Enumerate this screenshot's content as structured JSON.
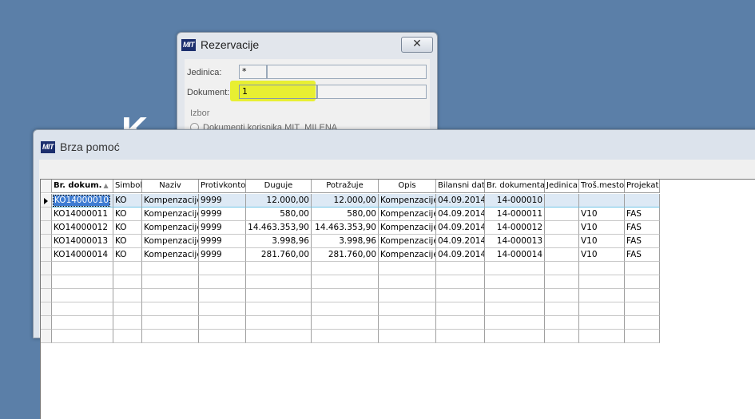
{
  "background": {
    "letter": "K"
  },
  "rezervacije": {
    "title": "Rezervacije",
    "close_glyph": "✕",
    "jedinica_label": "Jedinica:",
    "jedinica_value": "*",
    "jedinica_value2": "",
    "dokument_label": "Dokument:",
    "dokument_value": "1",
    "dokument_value2": "",
    "izbor_label": "Izbor",
    "option_text": "Dokumenti korisnika MIT_MILENA"
  },
  "brza_pomoc": {
    "logo": "MIT",
    "title": "Brza pomoć",
    "columns": [
      "Br. dokum.",
      "Simbol",
      "Naziv",
      "Protivkonto",
      "Duguje",
      "Potražuje",
      "Opis",
      "Bilansni dat.",
      "Br. dokumenta",
      "Jedinica",
      "Troš.mesto",
      "Projekat"
    ],
    "rows": [
      [
        "KO14000010",
        "KO",
        "Kompenzacije",
        "9999",
        "12.000,00",
        "12.000,00",
        "Kompenzacije",
        "04.09.2014",
        "14-000010",
        "",
        "",
        ""
      ],
      [
        "KO14000011",
        "KO",
        "Kompenzacije",
        "9999",
        "580,00",
        "580,00",
        "Kompenzacije",
        "04.09.2014",
        "14-000011",
        "",
        "V10",
        "FAS"
      ],
      [
        "KO14000012",
        "KO",
        "Kompenzacije",
        "9999",
        "14.463.353,90",
        "14.463.353,90",
        "Kompenzacije",
        "04.09.2014",
        "14-000012",
        "",
        "V10",
        "FAS"
      ],
      [
        "KO14000013",
        "KO",
        "Kompenzacije",
        "9999",
        "3.998,96",
        "3.998,96",
        "Kompenzacije",
        "04.09.2014",
        "14-000013",
        "",
        "V10",
        "FAS"
      ],
      [
        "KO14000014",
        "KO",
        "Kompenzacije",
        "9999",
        "281.760,00",
        "281.760,00",
        "Kompenzacije",
        "04.09.2014",
        "14-000014",
        "",
        "V10",
        "FAS"
      ]
    ],
    "selected_row": 0,
    "sort_column": 0
  },
  "colors": {
    "selection": "#3e7cd2",
    "highlight": "#e7ee1d",
    "desktop": "#5b7fa8"
  }
}
